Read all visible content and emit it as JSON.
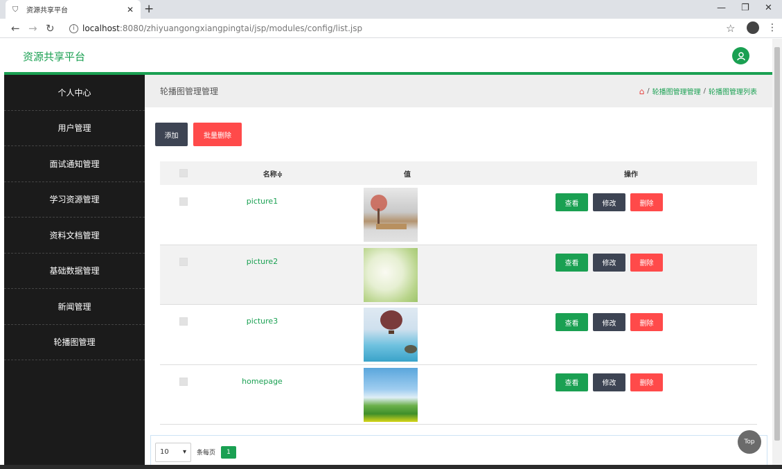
{
  "browser": {
    "tab_title": "资源共享平台",
    "url_host": "localhost",
    "url_path": ":8080/zhiyuangongxiangpingtai/jsp/modules/config/list.jsp"
  },
  "header": {
    "logo": "资源共享平台"
  },
  "sidebar": {
    "items": [
      {
        "label": "个人中心"
      },
      {
        "label": "用户管理"
      },
      {
        "label": "面试通知管理"
      },
      {
        "label": "学习资源管理"
      },
      {
        "label": "资料文档管理"
      },
      {
        "label": "基础数据管理"
      },
      {
        "label": "新闻管理"
      },
      {
        "label": "轮播图管理"
      }
    ]
  },
  "main": {
    "page_title": "轮播图管理管理",
    "breadcrumb": [
      "轮播图管理管理",
      "轮播图管理列表"
    ],
    "add_label": "添加",
    "batch_delete_label": "批量删除",
    "table": {
      "headers": [
        "名称≑",
        "值",
        "操作"
      ],
      "rows": [
        {
          "name": "picture1"
        },
        {
          "name": "picture2"
        },
        {
          "name": "picture3"
        },
        {
          "name": "homepage"
        }
      ],
      "view_label": "查看",
      "edit_label": "修改",
      "delete_label": "删除"
    },
    "pager": {
      "page_size": "10",
      "per_page_text": "条每页",
      "current_page": "1"
    }
  },
  "top_button": "Top",
  "colors": {
    "accent": "#1aa052",
    "danger": "#ff4a4a",
    "dark": "#3d4453",
    "sidebar": "#1b1b1b"
  }
}
